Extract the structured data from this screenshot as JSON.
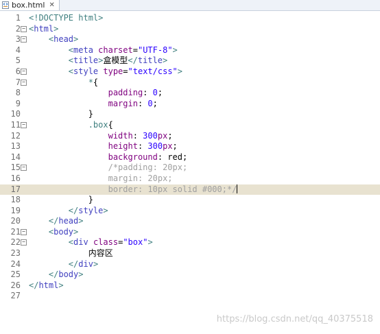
{
  "tab": {
    "title": "box.html",
    "close_glyph": "✕"
  },
  "lines": [
    {
      "n": "1",
      "fold": false,
      "tokens": [
        {
          "t": "<!DOCTYPE html>",
          "c": "tagb"
        }
      ]
    },
    {
      "n": "2",
      "fold": true,
      "tokens": [
        {
          "t": "<",
          "c": "tagb"
        },
        {
          "t": "html",
          "c": "tag"
        },
        {
          "t": ">",
          "c": "tagb"
        }
      ]
    },
    {
      "n": "3",
      "fold": true,
      "tokens": [
        {
          "t": "    <",
          "c": "tagb"
        },
        {
          "t": "head",
          "c": "tag"
        },
        {
          "t": ">",
          "c": "tagb"
        }
      ]
    },
    {
      "n": "4",
      "fold": false,
      "tokens": [
        {
          "t": "        <",
          "c": "tagb"
        },
        {
          "t": "meta",
          "c": "tag"
        },
        {
          "t": " charset",
          "c": "attr"
        },
        {
          "t": "=",
          "c": "plain"
        },
        {
          "t": "\"UTF-8\"",
          "c": "val"
        },
        {
          "t": ">",
          "c": "tagb"
        }
      ]
    },
    {
      "n": "5",
      "fold": false,
      "tokens": [
        {
          "t": "        <",
          "c": "tagb"
        },
        {
          "t": "title",
          "c": "tag"
        },
        {
          "t": ">",
          "c": "tagb"
        },
        {
          "t": "盒模型",
          "c": "plain"
        },
        {
          "t": "</",
          "c": "tagb"
        },
        {
          "t": "title",
          "c": "tag"
        },
        {
          "t": ">",
          "c": "tagb"
        }
      ]
    },
    {
      "n": "6",
      "fold": true,
      "tokens": [
        {
          "t": "        <",
          "c": "tagb"
        },
        {
          "t": "style",
          "c": "tag"
        },
        {
          "t": " type",
          "c": "attr"
        },
        {
          "t": "=",
          "c": "plain"
        },
        {
          "t": "\"text/css\"",
          "c": "val"
        },
        {
          "t": ">",
          "c": "tagb"
        }
      ]
    },
    {
      "n": "7",
      "fold": true,
      "tokens": [
        {
          "t": "            *",
          "c": "sel"
        },
        {
          "t": "{",
          "c": "plain"
        }
      ]
    },
    {
      "n": "8",
      "fold": false,
      "tokens": [
        {
          "t": "                padding",
          "c": "prop"
        },
        {
          "t": ": ",
          "c": "plain"
        },
        {
          "t": "0",
          "c": "num"
        },
        {
          "t": ";",
          "c": "plain"
        }
      ]
    },
    {
      "n": "9",
      "fold": false,
      "tokens": [
        {
          "t": "                margin",
          "c": "prop"
        },
        {
          "t": ": ",
          "c": "plain"
        },
        {
          "t": "0",
          "c": "num"
        },
        {
          "t": ";",
          "c": "plain"
        }
      ]
    },
    {
      "n": "10",
      "fold": false,
      "tokens": [
        {
          "t": "            }",
          "c": "plain"
        }
      ]
    },
    {
      "n": "11",
      "fold": true,
      "tokens": [
        {
          "t": "            .box",
          "c": "sel"
        },
        {
          "t": "{",
          "c": "plain"
        }
      ]
    },
    {
      "n": "12",
      "fold": false,
      "tokens": [
        {
          "t": "                width",
          "c": "prop"
        },
        {
          "t": ": ",
          "c": "plain"
        },
        {
          "t": "300",
          "c": "num"
        },
        {
          "t": "px",
          "c": "prop"
        },
        {
          "t": ";",
          "c": "plain"
        }
      ]
    },
    {
      "n": "13",
      "fold": false,
      "tokens": [
        {
          "t": "                height",
          "c": "prop"
        },
        {
          "t": ": ",
          "c": "plain"
        },
        {
          "t": "300",
          "c": "num"
        },
        {
          "t": "px",
          "c": "prop"
        },
        {
          "t": ";",
          "c": "plain"
        }
      ]
    },
    {
      "n": "14",
      "fold": false,
      "tokens": [
        {
          "t": "                background",
          "c": "prop"
        },
        {
          "t": ": red;",
          "c": "plain"
        }
      ]
    },
    {
      "n": "15",
      "fold": true,
      "tokens": [
        {
          "t": "                /*padding: 20px;",
          "c": "comment"
        }
      ]
    },
    {
      "n": "16",
      "fold": false,
      "tokens": [
        {
          "t": "                margin: 20px;",
          "c": "comment"
        }
      ]
    },
    {
      "n": "17",
      "fold": false,
      "current": true,
      "tokens": [
        {
          "t": "                border: 10px solid #000;*/",
          "c": "comment"
        }
      ]
    },
    {
      "n": "18",
      "fold": false,
      "tokens": [
        {
          "t": "            }",
          "c": "plain"
        }
      ]
    },
    {
      "n": "19",
      "fold": false,
      "tokens": [
        {
          "t": "        </",
          "c": "tagb"
        },
        {
          "t": "style",
          "c": "tag"
        },
        {
          "t": ">",
          "c": "tagb"
        }
      ]
    },
    {
      "n": "20",
      "fold": false,
      "tokens": [
        {
          "t": "    </",
          "c": "tagb"
        },
        {
          "t": "head",
          "c": "tag"
        },
        {
          "t": ">",
          "c": "tagb"
        }
      ]
    },
    {
      "n": "21",
      "fold": true,
      "tokens": [
        {
          "t": "    <",
          "c": "tagb"
        },
        {
          "t": "body",
          "c": "tag"
        },
        {
          "t": ">",
          "c": "tagb"
        }
      ]
    },
    {
      "n": "22",
      "fold": true,
      "tokens": [
        {
          "t": "        <",
          "c": "tagb"
        },
        {
          "t": "div",
          "c": "tag"
        },
        {
          "t": " class",
          "c": "attr"
        },
        {
          "t": "=",
          "c": "plain"
        },
        {
          "t": "\"box\"",
          "c": "val"
        },
        {
          "t": ">",
          "c": "tagb"
        }
      ]
    },
    {
      "n": "23",
      "fold": false,
      "tokens": [
        {
          "t": "            内容区",
          "c": "plain"
        }
      ]
    },
    {
      "n": "24",
      "fold": false,
      "tokens": [
        {
          "t": "        </",
          "c": "tagb"
        },
        {
          "t": "div",
          "c": "tag"
        },
        {
          "t": ">",
          "c": "tagb"
        }
      ]
    },
    {
      "n": "25",
      "fold": false,
      "tokens": [
        {
          "t": "    </",
          "c": "tagb"
        },
        {
          "t": "body",
          "c": "tag"
        },
        {
          "t": ">",
          "c": "tagb"
        }
      ]
    },
    {
      "n": "26",
      "fold": false,
      "tokens": [
        {
          "t": "</",
          "c": "tagb"
        },
        {
          "t": "html",
          "c": "tag"
        },
        {
          "t": ">",
          "c": "tagb"
        }
      ]
    },
    {
      "n": "27",
      "fold": false,
      "tokens": []
    }
  ],
  "watermark": "https://blog.csdn.net/qq_40375518",
  "colors": {
    "current_line": "#e8e2d0",
    "tag_bracket": "#3f7f7f",
    "tag_name": "#3f3fbf",
    "attribute": "#7f007f",
    "string": "#2a00ff",
    "comment": "#a0a0a0"
  }
}
